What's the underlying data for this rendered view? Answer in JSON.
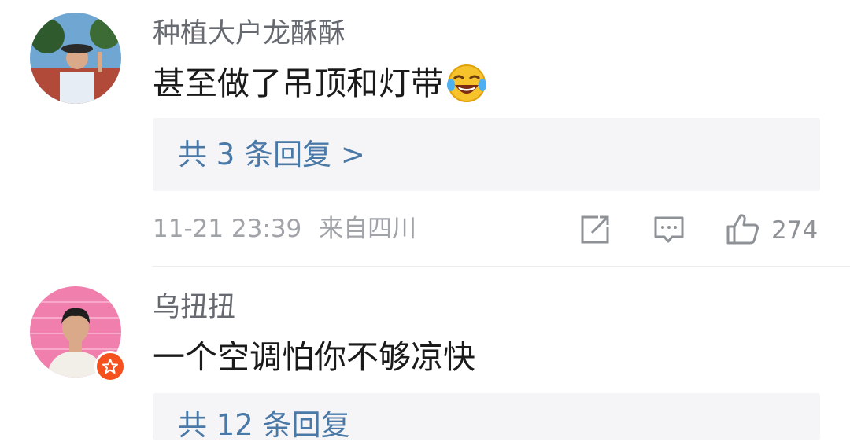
{
  "comments": [
    {
      "username": "种植大户龙酥酥",
      "text": "甚至做了吊顶和灯带",
      "emoji": "laughing-tears-emoji",
      "replies_label": "共 3 条回复 >",
      "time": "11-21 23:39",
      "location": "来自四川",
      "like_count": "274"
    },
    {
      "username": "乌扭扭",
      "text": "一个空调怕你不够凉快",
      "badge": "star-badge-icon",
      "replies_label": "共 12 条回复"
    }
  ],
  "icons": {
    "share": "share-icon",
    "comment": "comment-icon",
    "like": "thumbs-up-icon"
  },
  "colors": {
    "link": "#4a79a7",
    "badge": "#f4511e",
    "reply_bg": "#f5f5f7"
  }
}
